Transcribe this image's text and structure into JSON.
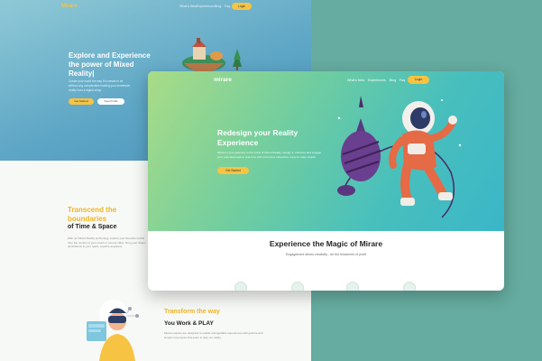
{
  "background_page": {
    "logo": "Mirare",
    "nav": [
      "What's New",
      "Experiences",
      "Blog",
      "Faq"
    ],
    "login": "Login",
    "hero_title": "Explore and Experience the power of Mixed Reality|",
    "hero_desc": "Create your world the way it is meant to be without any complexities leading your immersive reality from a digital setup.",
    "btn_primary": "Get Started",
    "btn_secondary": "View Profile",
    "section2": {
      "title": "Transcend the boundaries",
      "subtitle": "of Time & Space",
      "desc": "With our Mixed Reality technology, explore your favourite worlds from the comfort of your couch or remote office, bring your dream destinations to your reach, anytime anywhere."
    },
    "section3": {
      "title": "Transform the way",
      "subtitle": "You Work & PLAY",
      "desc": "Mirare engines are designed to enable unforgettable experiences with gesture and simple movements that seem to defy our reality."
    }
  },
  "card": {
    "logo": "mirare",
    "nav": [
      "What's New",
      "Experiences",
      "Blog",
      "Faq"
    ],
    "login": "Login",
    "hero_title": "Redesign your Reality Experience",
    "hero_desc": "Mirare is your gateway to the world of Mixed Reality. Design it, enhance and engage your potential leads in real-time with immersive interactive content made simple.",
    "cta": "Get Started",
    "section_title": "Experience the Magic of Mirare",
    "section_subtitle": "Engagement drives creativity - be the testament of profit"
  },
  "colors": {
    "accent_yellow": "#f6c343",
    "teal_right": "#66aca0",
    "hero_gradient_start": "#a9dc87",
    "hero_gradient_end": "#3ab6c8"
  }
}
